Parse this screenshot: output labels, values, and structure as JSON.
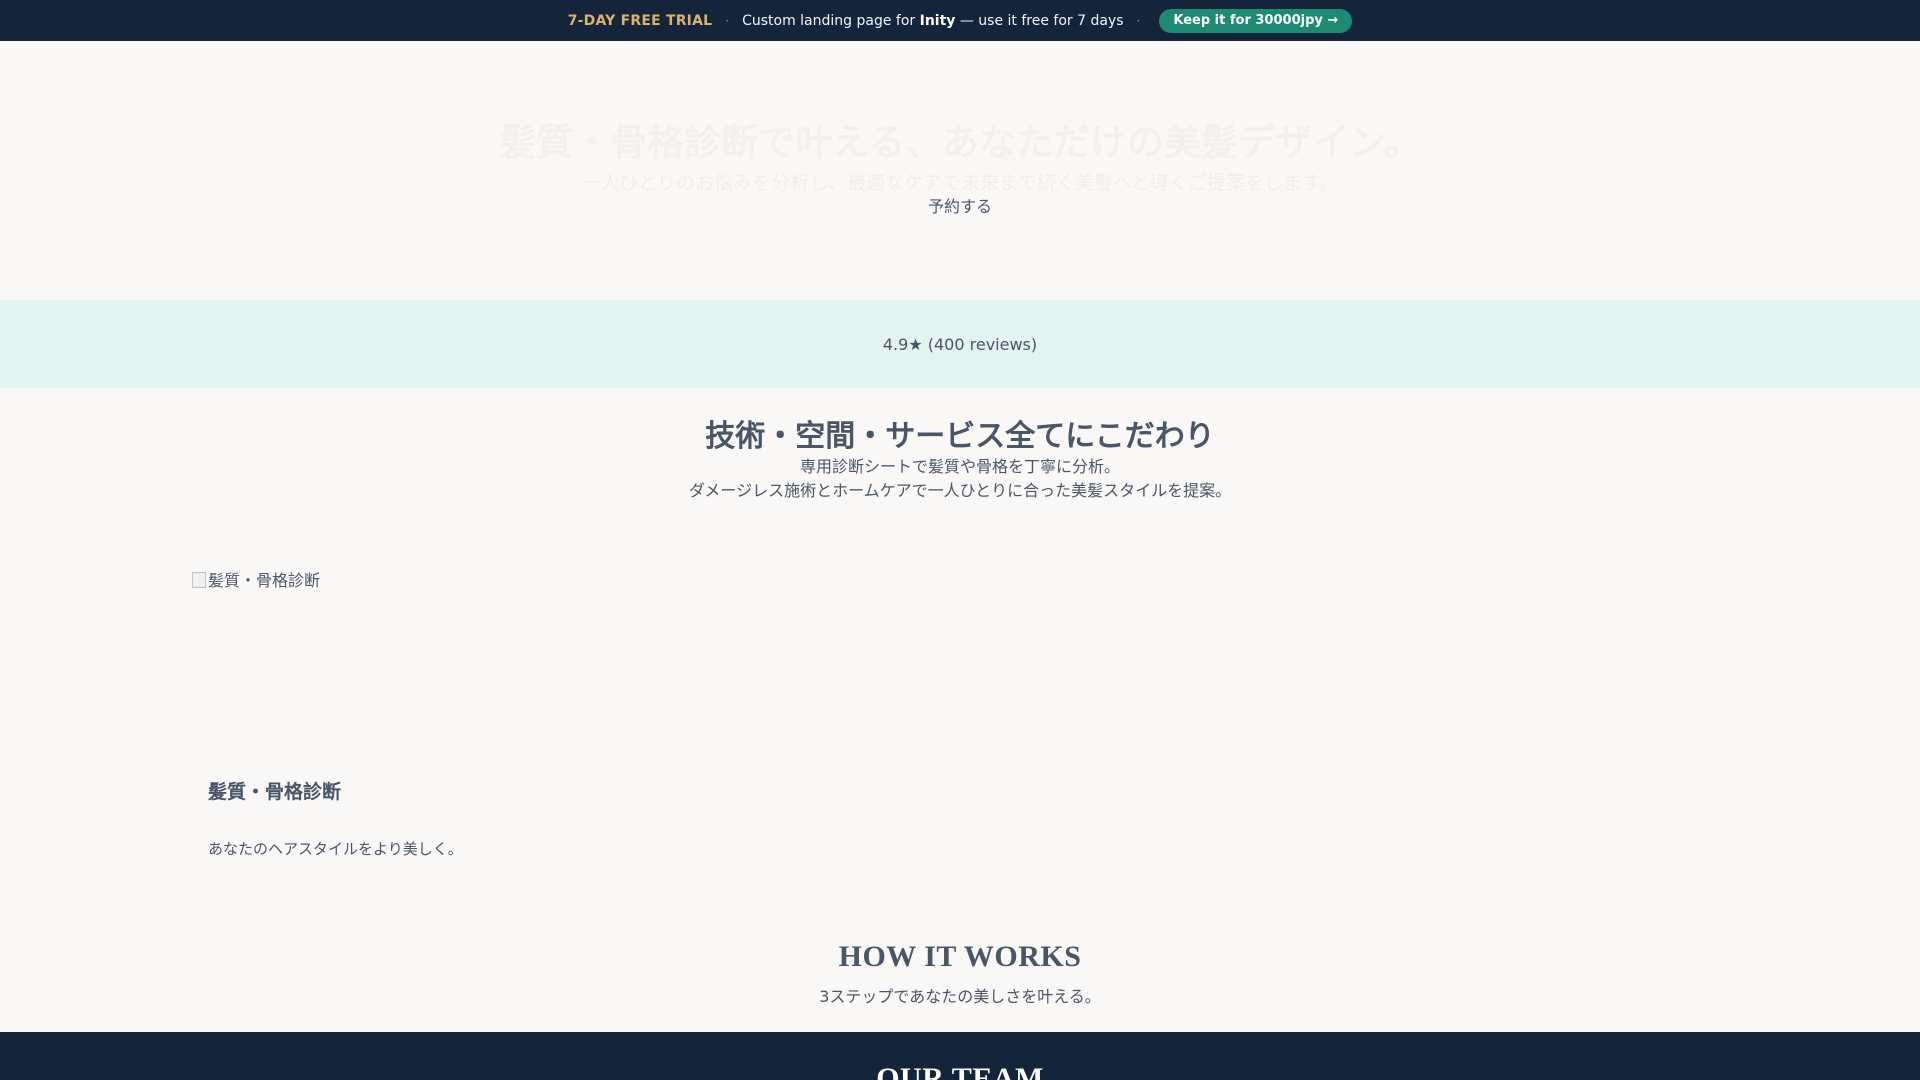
{
  "banner": {
    "trial_label": "7-DAY FREE TRIAL",
    "separator": "·",
    "message_prefix": "Custom landing page for ",
    "brand": "Inity",
    "message_suffix": " — use it free for 7 days",
    "cta_label": "Keep it for 30000jpy →"
  },
  "hero": {
    "title": "髪質・骨格診断で叶える、あなただけの美髪デザイン。",
    "subtitle": "一人ひとりのお悩みを分析し、最適なケアで未来まで続く美髪へと導くご提案をします。",
    "reserve_label": "予約する"
  },
  "rating": {
    "text": "4.9★ (400 reviews)"
  },
  "features": {
    "title": "技術・空間・サービス全てにこだわり",
    "desc_line1": "専用診断シートで髪質や骨格を丁寧に分析。",
    "desc_line2": "ダメージレス施術とホームケアで一人ひとりに合った美髪スタイルを提案。",
    "card": {
      "image_alt": "髪質・骨格診断",
      "title": "髪質・骨格診断",
      "text": "あなたのヘアスタイルをより美しく。"
    }
  },
  "how_it_works": {
    "title": "HOW IT WORKS",
    "subtitle": "3ステップであなたの美しさを叶える。"
  },
  "team": {
    "title": "OUR TEAM"
  },
  "colors": {
    "banner_bg": "#14253b",
    "trial_gold": "#d8b36a",
    "cta_green": "#1d8b73",
    "rating_bg": "#e5f3f0",
    "page_bg": "#faf8f6",
    "text": "#4a5568"
  }
}
